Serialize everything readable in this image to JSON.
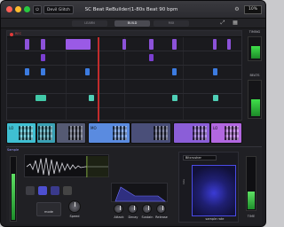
{
  "titlebar": {
    "preset": "Devil Glitch",
    "title": "SC Beat ReBuilder(1-80s Beat 90 bpm",
    "zoom": "10%"
  },
  "tabs": [
    {
      "label": "LEARN",
      "active": false
    },
    {
      "label": "BUILD",
      "active": true
    },
    {
      "label": "MIX",
      "active": false
    }
  ],
  "arranger": {
    "label": "REC"
  },
  "side": {
    "top_label": "TIMING",
    "beats_label": "BEATS",
    "low_label": "TIME",
    "top_level": 0.6,
    "beats_level": 0.5,
    "low_level": 0.35
  },
  "clips": [
    {
      "label": "LO",
      "color": "#3fbfd2"
    },
    {
      "label": "",
      "color": "#3aa0b4"
    },
    {
      "label": "",
      "color": "#555a73"
    },
    {
      "label": "MO",
      "color": "#5a8be0"
    },
    {
      "label": "",
      "color": "#4a4f79"
    },
    {
      "label": "",
      "color": "#8b5ed8"
    },
    {
      "label": "LO",
      "color": "#b267e0"
    }
  ],
  "bottom": {
    "tag": "Sample",
    "mode_label": "mode",
    "speed_label": "Speed",
    "knobs": [
      "Attack",
      "Decay",
      "Sustain",
      "Release"
    ],
    "bitcrush": {
      "name": "Bitcrusher",
      "bits_label": "bits",
      "rate_label": "sample rate"
    },
    "meter_level": 0.75
  }
}
